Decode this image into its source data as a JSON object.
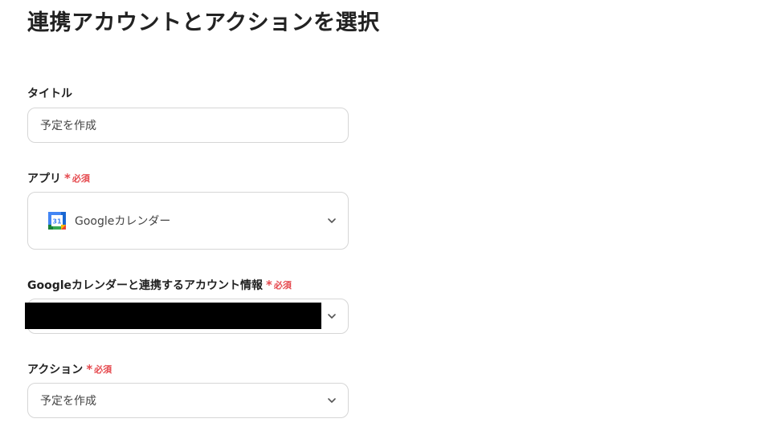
{
  "page": {
    "title": "連携アカウントとアクションを選択"
  },
  "required_mark": {
    "star": "*",
    "text": "必須"
  },
  "fields": {
    "title": {
      "label": "タイトル",
      "value": "予定を作成"
    },
    "app": {
      "label": "アプリ",
      "value": "Googleカレンダー",
      "icon": "google-calendar-icon",
      "icon_text": "31"
    },
    "account": {
      "label": "Googleカレンダーと連携するアカウント情報",
      "value": ""
    },
    "action": {
      "label": "アクション",
      "value": "予定を作成"
    }
  },
  "colors": {
    "required": "#e5484d",
    "border": "#d6d6d6",
    "text": "#222222"
  }
}
